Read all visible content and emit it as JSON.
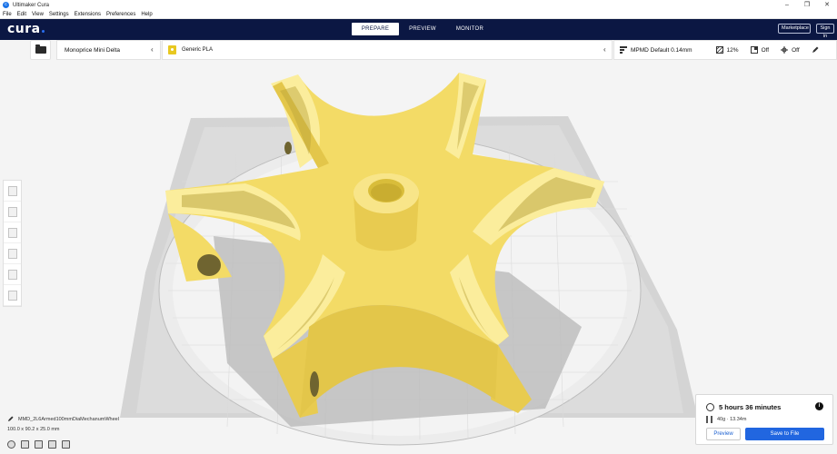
{
  "window": {
    "title": "Ultimaker Cura",
    "controls": [
      "–",
      "❐",
      "✕"
    ]
  },
  "menu": [
    "File",
    "Edit",
    "View",
    "Settings",
    "Extensions",
    "Preferences",
    "Help"
  ],
  "header": {
    "logo": "cura",
    "tabs": [
      {
        "label": "PREPARE",
        "active": true
      },
      {
        "label": "PREVIEW",
        "active": false
      },
      {
        "label": "MONITOR",
        "active": false
      }
    ],
    "marketplace_label": "Marketplace",
    "signin_label": "Sign in"
  },
  "toolbar": {
    "printer": "Monoprice Mini Delta",
    "material": "Generic PLA",
    "profile": "MPMD Default 0.14mm",
    "infill": "12%",
    "support": "Off",
    "adhesion": "Off"
  },
  "left_tools": [
    "move-tool",
    "scale-tool",
    "rotate-tool",
    "mirror-tool",
    "per-model-settings-tool",
    "support-blocker-tool"
  ],
  "object": {
    "name": "MMD_2L6Armed100mmDiaMechanumWheel",
    "dimensions": "100.0 x 90.2 x 25.0 mm"
  },
  "print_panel": {
    "time": "5 hours 36 minutes",
    "material": "40g · 13.34m",
    "preview_label": "Preview",
    "save_label": "Save to File"
  },
  "colors": {
    "header": "#0b1743",
    "accent": "#2166e0",
    "model": "#f3db66",
    "model_light": "#fbed9c",
    "model_shadow": "#d9bd3a",
    "build_plate": "#cfcfcf"
  }
}
